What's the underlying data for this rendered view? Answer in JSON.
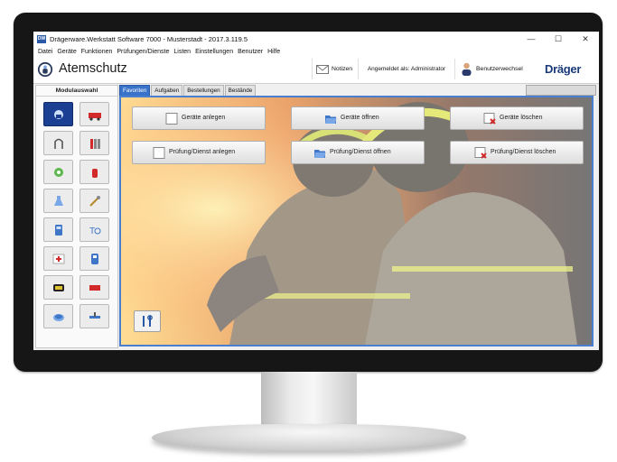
{
  "window": {
    "title": "Drägerware.Werkstatt Software 7000 - Musterstadt - 2017.3.119.5",
    "icon_text": "DW",
    "minimize": "—",
    "maximize": "☐",
    "close": "✕"
  },
  "menu": [
    "Datei",
    "Geräte",
    "Funktionen",
    "Prüfungen/Dienste",
    "Listen",
    "Einstellungen",
    "Benutzer",
    "Hilfe"
  ],
  "header": {
    "title": "Atemschutz",
    "notifications_label": "Notizen",
    "logged_in": "Angemeldet als: Administrator",
    "user_change_label": "Benutzerwechsel",
    "brand": "Dräger"
  },
  "sidebar": {
    "heading": "Modulauswahl",
    "tiles": [
      {
        "icon": "mask-icon",
        "active": true
      },
      {
        "icon": "fire-truck-icon"
      },
      {
        "icon": "hose-icon"
      },
      {
        "icon": "cylinder-rack-icon"
      },
      {
        "icon": "regulator-icon"
      },
      {
        "icon": "extinguisher-icon"
      },
      {
        "icon": "flask-icon"
      },
      {
        "icon": "tools-icon"
      },
      {
        "icon": "meter-icon"
      },
      {
        "icon": "test-device-icon"
      },
      {
        "icon": "first-aid-icon"
      },
      {
        "icon": "chemical-suit-icon"
      },
      {
        "icon": "gas-detector-icon"
      },
      {
        "icon": "red-device-icon"
      },
      {
        "icon": "filter-icon"
      },
      {
        "icon": "valve-icon"
      }
    ]
  },
  "tabs": [
    "Favoriten",
    "Aufgaben",
    "Bestellungen",
    "Bestände"
  ],
  "active_tab": "Favoriten",
  "favorites": {
    "buttons": [
      {
        "label": "Geräte anlegen",
        "icon": "blank-doc-icon"
      },
      {
        "label": "Geräte öffnen",
        "icon": "open-folder-icon"
      },
      {
        "label": "Geräte löschen",
        "icon": "delete-doc-icon"
      },
      {
        "label": "Prüfung/Dienst anlegen",
        "icon": "blank-doc-icon"
      },
      {
        "label": "Prüfung/Dienst öffnen",
        "icon": "open-folder-icon"
      },
      {
        "label": "Prüfung/Dienst löschen",
        "icon": "delete-doc-icon"
      }
    ],
    "tools_button_icon": "tools-icon"
  },
  "colors": {
    "accent": "#3873c9",
    "sidebar_active": "#1b3f93",
    "brand": "#1a3a7a",
    "delete_red": "#d22a2a"
  }
}
